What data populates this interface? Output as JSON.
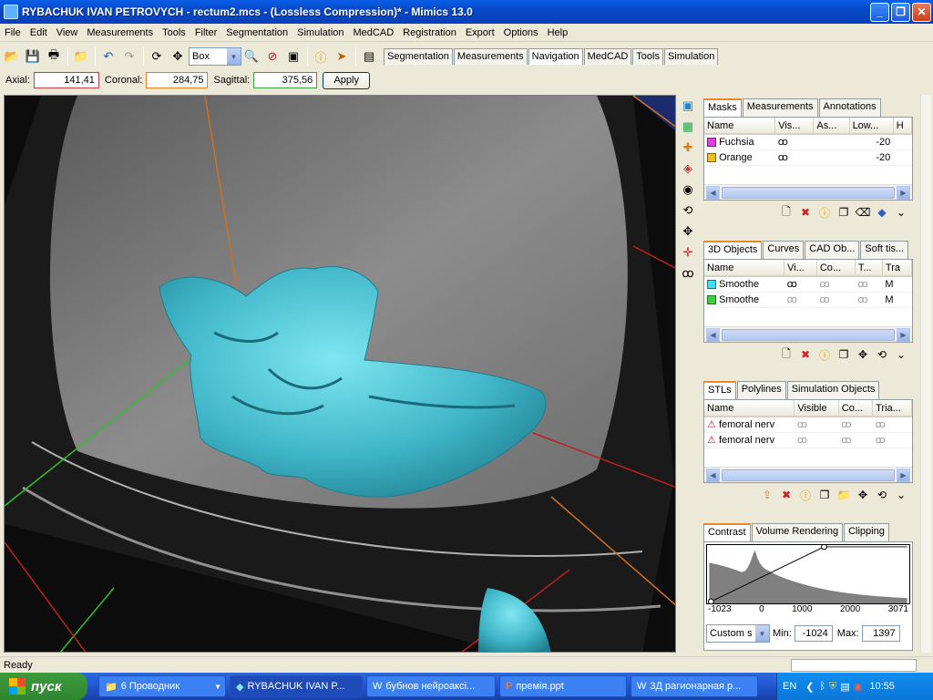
{
  "window": {
    "title": "RYBACHUK IVAN PETROVYCH - rectum2.mcs -  (Lossless Compression)* - Mimics  13.0"
  },
  "menu": [
    "File",
    "Edit",
    "View",
    "Measurements",
    "Tools",
    "Filter",
    "Segmentation",
    "Simulation",
    "MedCAD",
    "Registration",
    "Export",
    "Options",
    "Help"
  ],
  "toolbar": {
    "mode_select": "Box"
  },
  "top_tabs": [
    "Segmentation",
    "Measurements",
    "Navigation",
    "MedCAD",
    "Tools",
    "Simulation"
  ],
  "top_tabs_active": "Navigation",
  "coords": {
    "axial_label": "Axial:",
    "axial": "141,41",
    "coronal_label": "Coronal:",
    "coronal": "284,75",
    "sagittal_label": "Sagittal:",
    "sagittal": "375,56",
    "apply": "Apply"
  },
  "masks": {
    "tabs": [
      "Masks",
      "Measurements",
      "Annotations"
    ],
    "columns": [
      "Name",
      "Vis...",
      "As...",
      "Low...",
      "H"
    ],
    "rows": [
      {
        "name": "Fuchsia",
        "color": "#e040e0",
        "low": "-20"
      },
      {
        "name": "Orange",
        "color": "#f0c020",
        "low": "-20"
      }
    ]
  },
  "objects3d": {
    "tabs": [
      "3D Objects",
      "Curves",
      "CAD Ob...",
      "Soft tis..."
    ],
    "columns": [
      "Name",
      "Vi...",
      "Co...",
      "T...",
      "Tra"
    ],
    "rows": [
      {
        "name": "Smoothe",
        "color": "#40e0f0",
        "tra": "M"
      },
      {
        "name": "Smoothe",
        "color": "#40d040",
        "tra": "M"
      }
    ]
  },
  "stls": {
    "tabs": [
      "STLs",
      "Polylines",
      "Simulation Objects"
    ],
    "columns": [
      "Name",
      "Visible",
      "Co...",
      "Tria..."
    ],
    "rows": [
      {
        "name": "femoral nerv"
      },
      {
        "name": "femoral nerv"
      }
    ]
  },
  "contrast": {
    "tabs": [
      "Contrast",
      "Volume Rendering",
      "Clipping"
    ],
    "axis_ticks": [
      "-1023",
      "0",
      "1000",
      "2000",
      "3071"
    ],
    "preset": "Custom s",
    "min_label": "Min:",
    "min": "-1024",
    "max_label": "Max:",
    "max": "1397"
  },
  "status": {
    "text": "Ready"
  },
  "taskbar": {
    "start": "пуск",
    "tasks": [
      {
        "label": "6 Проводник",
        "active": false
      },
      {
        "label": "RYBACHUK IVAN P...",
        "active": true
      },
      {
        "label": "бубнов нейроаксі...",
        "active": false
      },
      {
        "label": "премія.ppt",
        "active": false
      },
      {
        "label": "3Д  рагионарная р...",
        "active": false
      }
    ],
    "lang": "EN",
    "clock": "10:55"
  },
  "colors": {
    "accent": "#0A5FE8",
    "mesh": "#3fb6c8",
    "viewport_bg": "#1c2b6e"
  }
}
